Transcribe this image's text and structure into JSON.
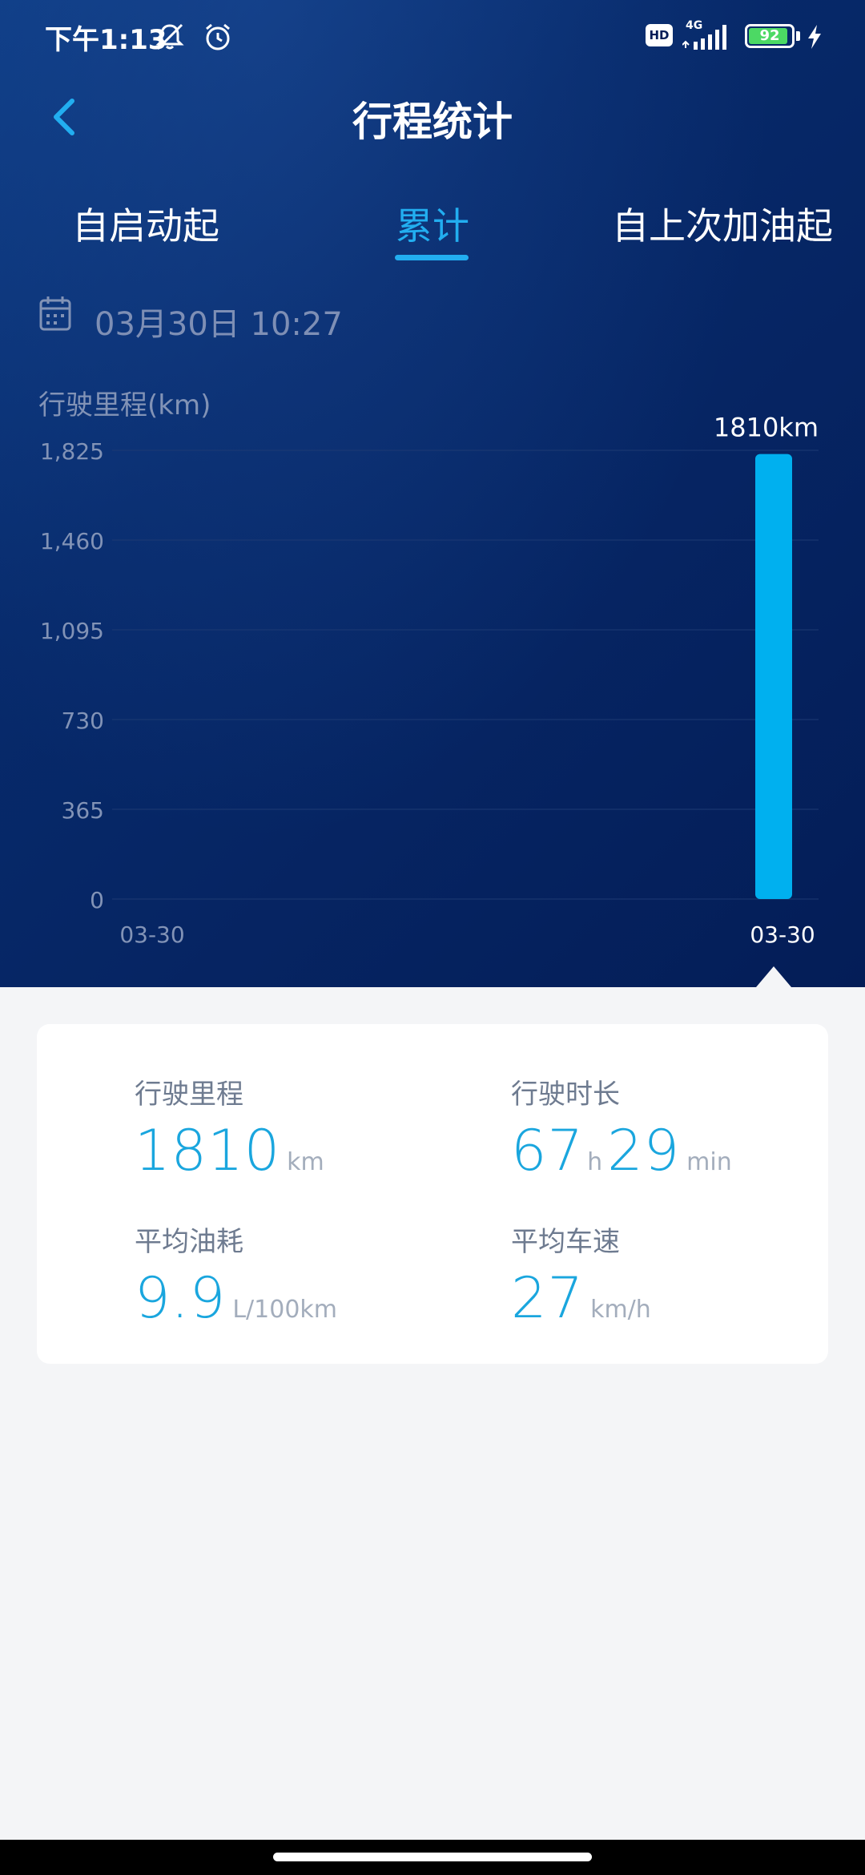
{
  "status_bar": {
    "time": "下午1:13",
    "hd_label": "HD",
    "network_label": "4G",
    "battery_level": "92",
    "battery_fraction": 0.92,
    "icons": [
      "mute-icon",
      "alarm-icon",
      "signal-icon",
      "battery-icon",
      "charging-icon"
    ]
  },
  "header": {
    "back_icon": "chevron-left-icon",
    "title": "行程统计"
  },
  "tabs": [
    {
      "label": "自启动起",
      "active": false
    },
    {
      "label": "累计",
      "active": true
    },
    {
      "label": "自上次加油起",
      "active": false
    }
  ],
  "date_row": {
    "icon": "calendar-icon",
    "date": "03月30日 10:27"
  },
  "chart_data": {
    "type": "bar",
    "ylabel": "行驶里程(km)",
    "y_ticks": [
      "1,825",
      "1,460",
      "1,095",
      "730",
      "365",
      "0"
    ],
    "ylim": [
      0,
      1825
    ],
    "x_tick_labels": [
      "03-30",
      "03-30"
    ],
    "categories": [
      "03-30"
    ],
    "values": [
      1810
    ],
    "value_label": "1810km",
    "grid": true,
    "colors": {
      "bar": "#00b0ef",
      "grid": "#1d3a73",
      "tick": "#8293b6",
      "selected_tick": "#ffffff"
    }
  },
  "summary": {
    "distance": {
      "label": "行驶里程",
      "value": "1810",
      "unit": "km"
    },
    "duration": {
      "label": "行驶时长",
      "hours": "67",
      "hours_unit": "h",
      "minutes": "29",
      "minutes_unit": "min"
    },
    "fuel": {
      "label": "平均油耗",
      "value": "9.9",
      "unit": "L/100km"
    },
    "speed": {
      "label": "平均车速",
      "value": "27",
      "unit": "km/h"
    }
  },
  "colors": {
    "accent": "#22aef0",
    "header_bg": "#041d57",
    "value_blue": "#1aa6de"
  }
}
